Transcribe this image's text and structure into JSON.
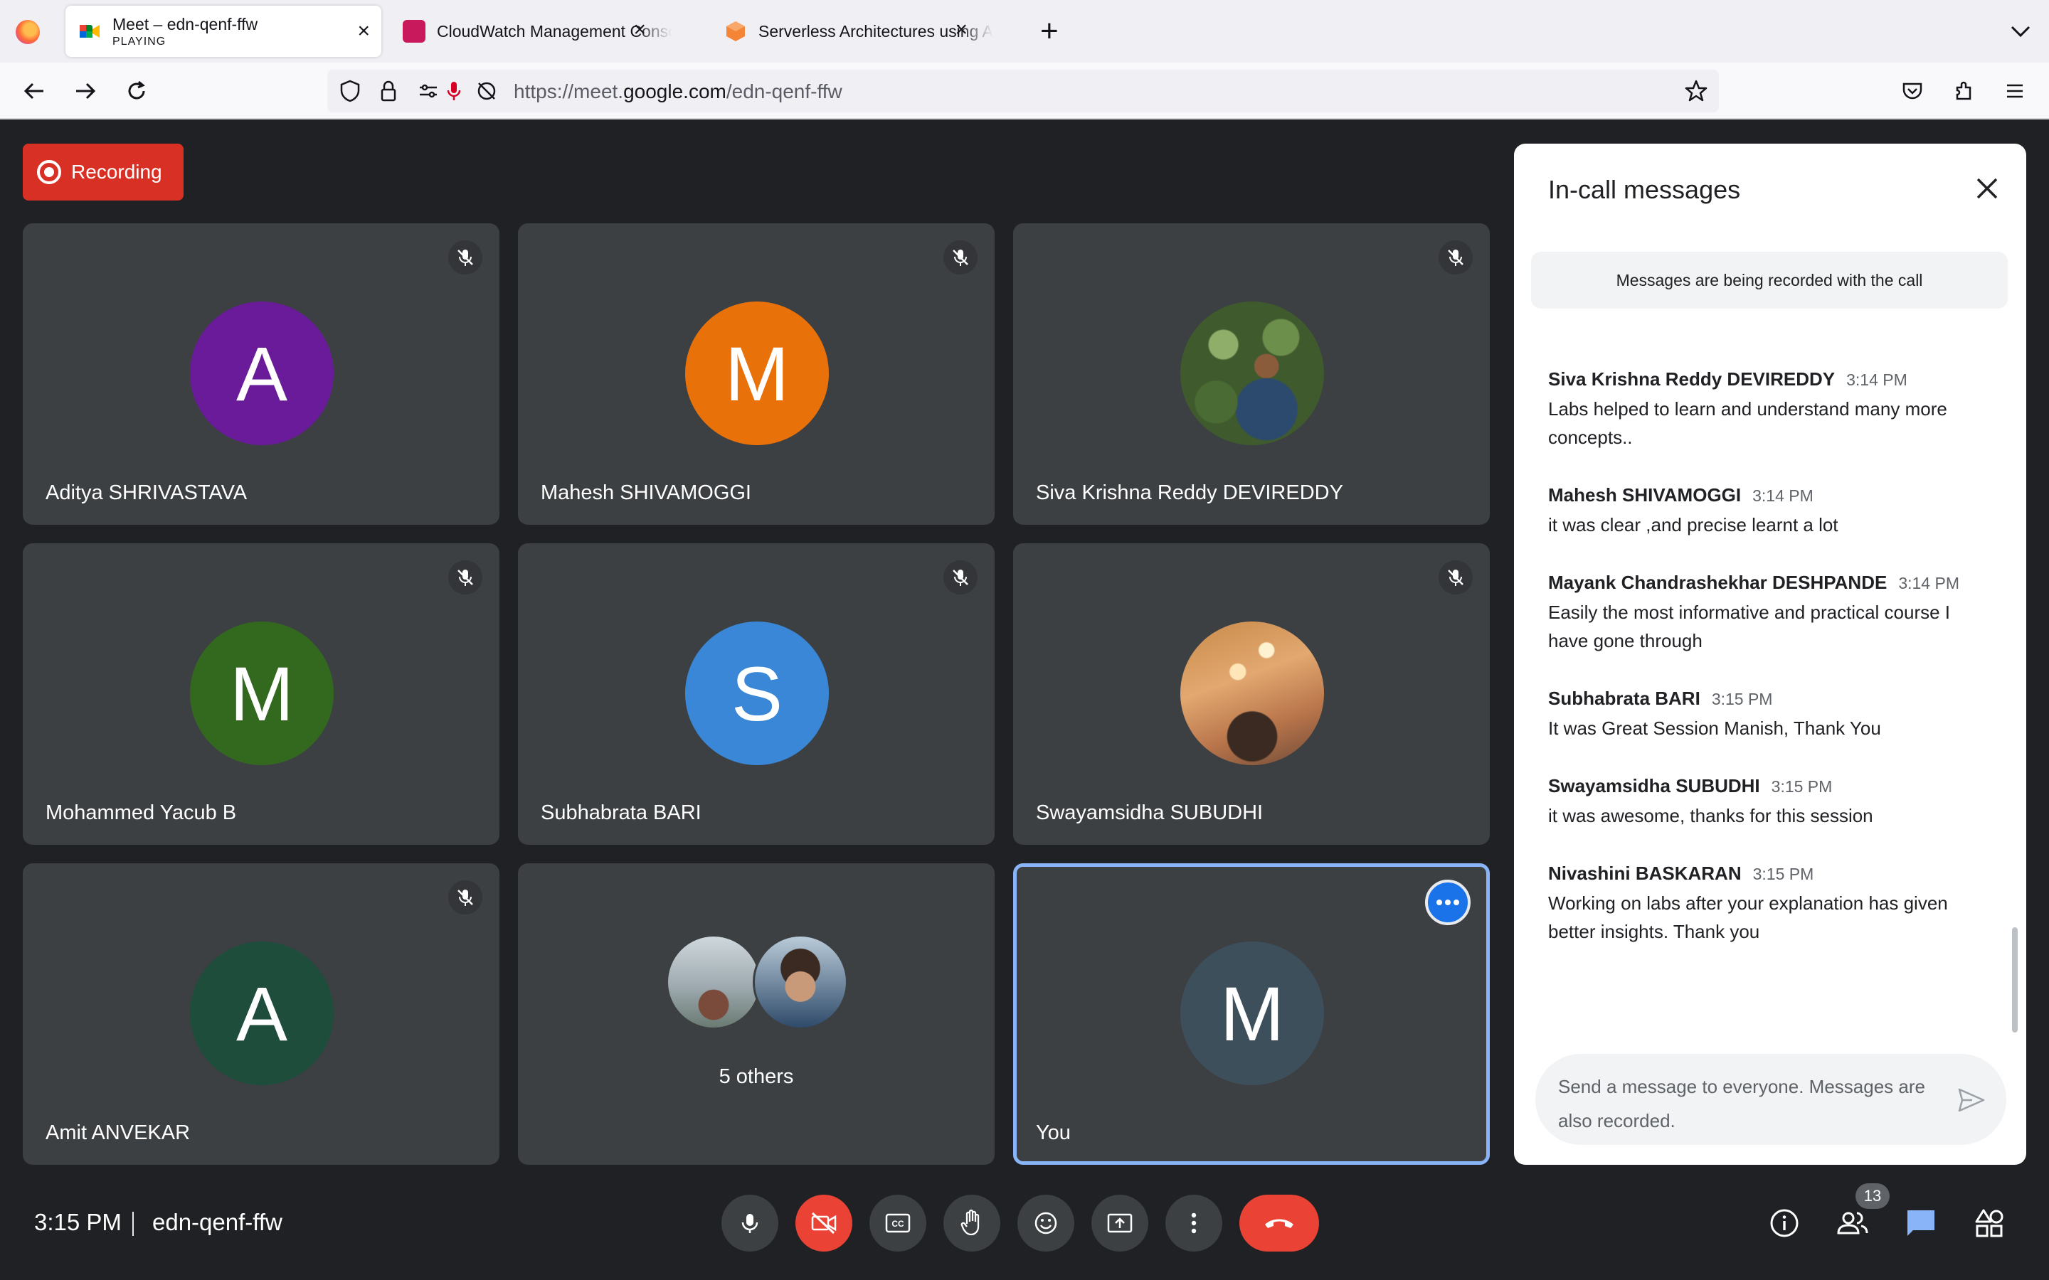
{
  "browser": {
    "tabs": [
      {
        "title": "Meet – edn-qenf-ffw",
        "subtitle": "PLAYING",
        "active": true
      },
      {
        "title": "CloudWatch Management Conso",
        "active": false
      },
      {
        "title": "Serverless Architectures using A",
        "active": false
      }
    ],
    "url_prefix": "https://meet.",
    "url_domain": "google.com",
    "url_path": "/edn-qenf-ffw"
  },
  "meeting": {
    "recording_label": "Recording",
    "tiles": [
      {
        "name": "Aditya SHRIVASTAVA",
        "initial": "A",
        "color": "#6a1b9a",
        "muted": true
      },
      {
        "name": "Mahesh SHIVAMOGGI",
        "initial": "M",
        "color": "#e8710a",
        "muted": true
      },
      {
        "name": "Siva Krishna Reddy DEVIREDDY",
        "initial": "",
        "photo": "foliage",
        "muted": true
      },
      {
        "name": "Mohammed Yacub B",
        "initial": "M",
        "color": "#33691e",
        "muted": true
      },
      {
        "name": "Subhabrata BARI",
        "initial": "S",
        "color": "#3987d6",
        "muted": true
      },
      {
        "name": "Swayamsidha SUBUDHI",
        "initial": "",
        "photo": "interior",
        "muted": true
      },
      {
        "name": "Amit ANVEKAR",
        "initial": "A",
        "color": "#1e4d3b",
        "muted": true
      },
      {
        "name": "",
        "others_label": "5 others"
      },
      {
        "name": "You",
        "initial": "M",
        "color": "#3e4f5c",
        "self": true
      }
    ]
  },
  "chat": {
    "title": "In-call messages",
    "notice": "Messages are being recorded with the call",
    "messages": [
      {
        "sender": "Siva Krishna Reddy DEVIREDDY",
        "time": "3:14 PM",
        "text": "Labs helped to learn and understand many more concepts.."
      },
      {
        "sender": "Mahesh SHIVAMOGGI",
        "time": "3:14 PM",
        "text": "it was clear ,and precise learnt a lot"
      },
      {
        "sender": "Mayank Chandrashekhar DESHPANDE",
        "time": "3:14 PM",
        "text": "Easily the most informative and practical course I have gone through"
      },
      {
        "sender": "Subhabrata BARI",
        "time": "3:15 PM",
        "text": "It was Great Session Manish, Thank You"
      },
      {
        "sender": "Swayamsidha SUBUDHI",
        "time": "3:15 PM",
        "text": "it was awesome,  thanks for this session"
      },
      {
        "sender": "Nivashini BASKARAN",
        "time": "3:15 PM",
        "text": "Working on labs after your explanation has  given better insights.  Thank you"
      }
    ],
    "input_placeholder": "Send a message to everyone. Messages are also recorded."
  },
  "bottom": {
    "time": "3:15 PM",
    "meeting_code": "edn-qenf-ffw",
    "participant_count": "13"
  },
  "colors": {
    "stage_bg": "#202124",
    "tile_bg": "#3c4043",
    "danger": "#ea4335",
    "accent": "#8ab4f8",
    "chat_active": "#8ab4f8"
  }
}
